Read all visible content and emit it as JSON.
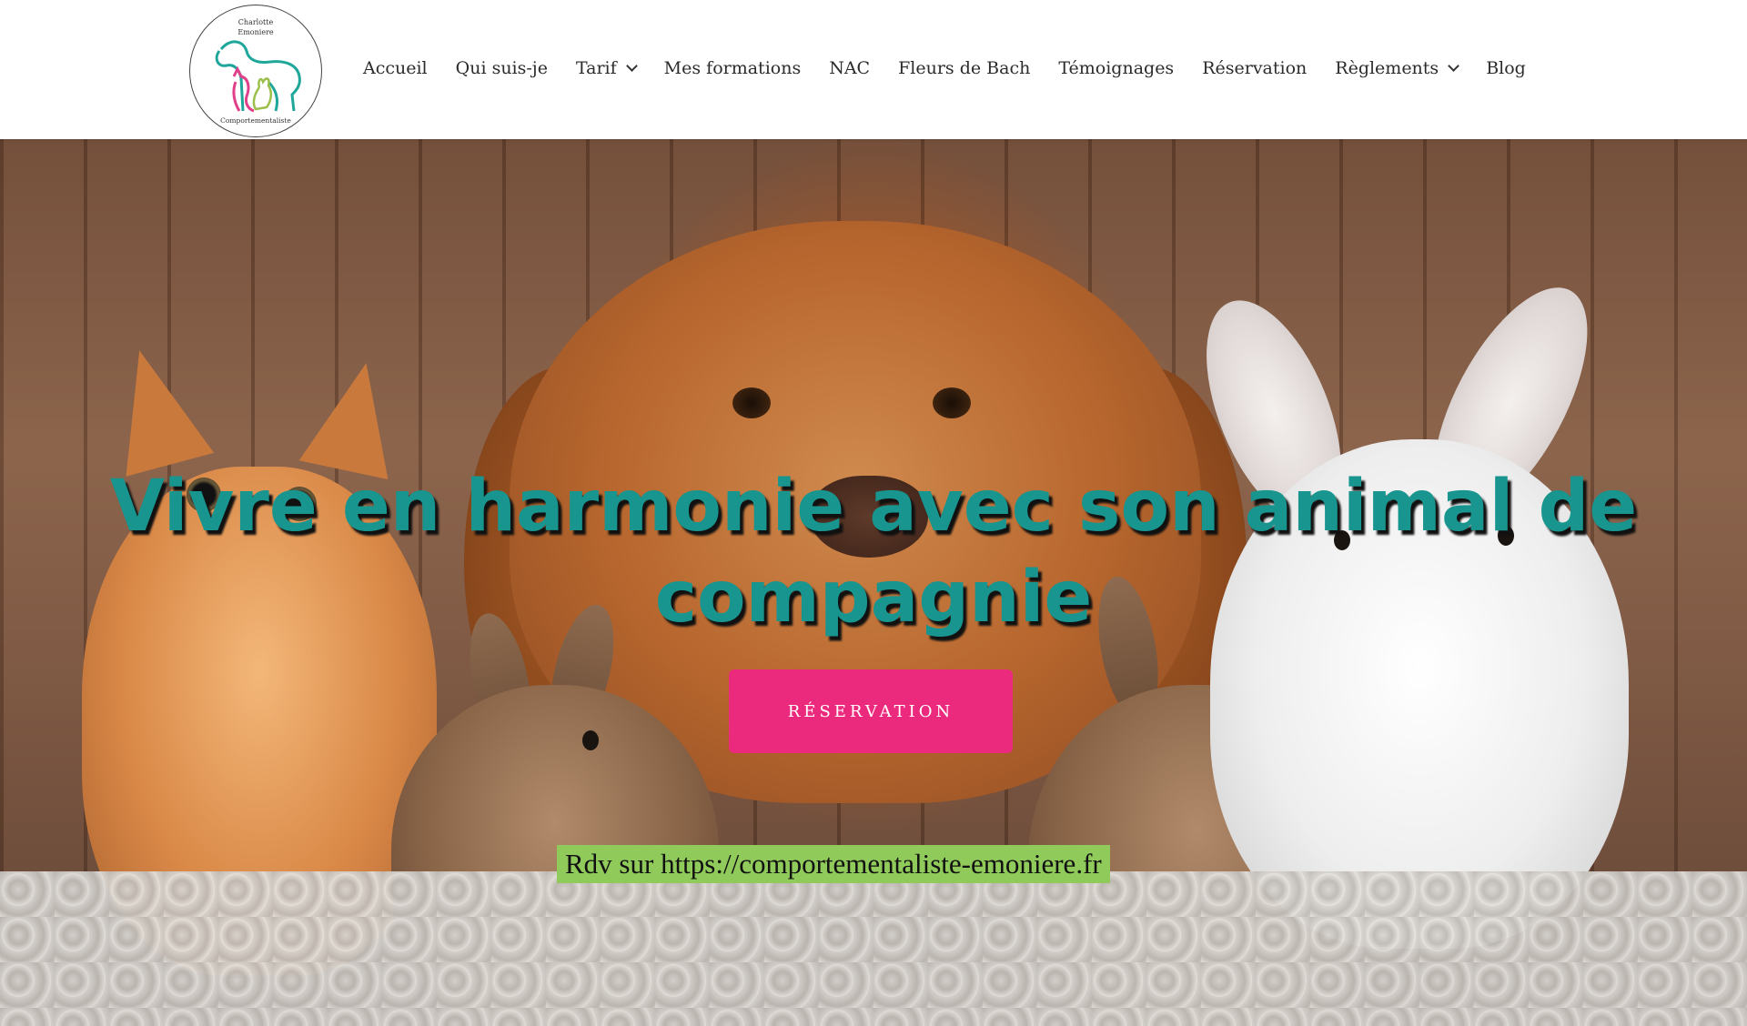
{
  "logo": {
    "name_line1": "Charlotte",
    "name_line2": "Emoniere",
    "subtitle": "Comportementaliste",
    "colors": [
      "#1fa69a",
      "#e0408a",
      "#9bbf4a"
    ]
  },
  "nav": {
    "items": [
      {
        "label": "Accueil",
        "has_dropdown": false
      },
      {
        "label": "Qui suis-je",
        "has_dropdown": false
      },
      {
        "label": "Tarif",
        "has_dropdown": true
      },
      {
        "label": "Mes formations",
        "has_dropdown": false
      },
      {
        "label": "NAC",
        "has_dropdown": false
      },
      {
        "label": "Fleurs de Bach",
        "has_dropdown": false
      },
      {
        "label": "Témoignages",
        "has_dropdown": false
      },
      {
        "label": "Réservation",
        "has_dropdown": false
      },
      {
        "label": "Règlements",
        "has_dropdown": true
      },
      {
        "label": "Blog",
        "has_dropdown": false
      }
    ]
  },
  "hero": {
    "title_line1": "Vivre en harmonie avec son animal de",
    "title_line2": "compagnie",
    "cta_label": "RÉSERVATION",
    "note": "Rdv sur https://comportementaliste-emoniere.fr",
    "title_color": "#19958f",
    "cta_color": "#ec2a7d",
    "note_bg": "#8fca5a"
  }
}
